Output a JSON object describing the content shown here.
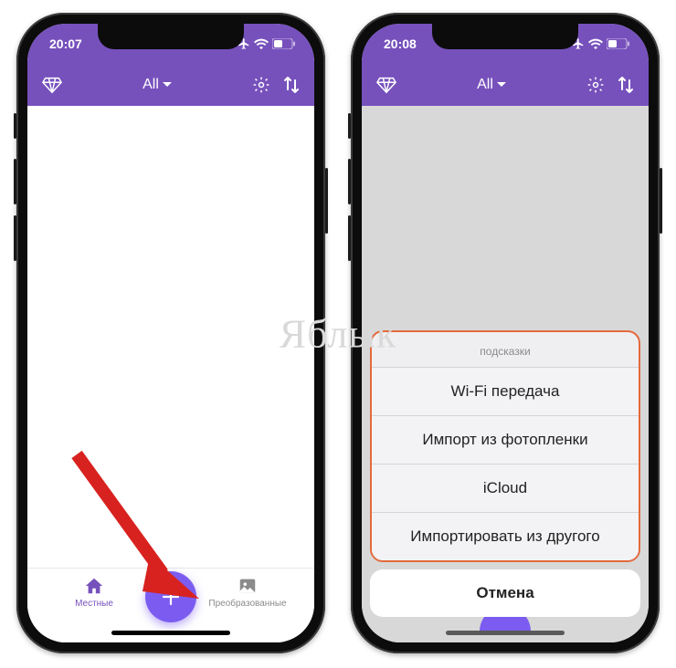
{
  "watermark": "Яблык",
  "phone1": {
    "time": "20:07",
    "header": {
      "title": "All"
    },
    "tabbar": {
      "left_label": "Местные",
      "right_label": "Преобразованные"
    }
  },
  "phone2": {
    "time": "20:08",
    "header": {
      "title": "All"
    },
    "sheet": {
      "title": "подсказки",
      "items": [
        "Wi-Fi передача",
        "Импорт из фотопленки",
        "iCloud",
        "Импортировать из другого"
      ],
      "cancel": "Отмена"
    }
  }
}
